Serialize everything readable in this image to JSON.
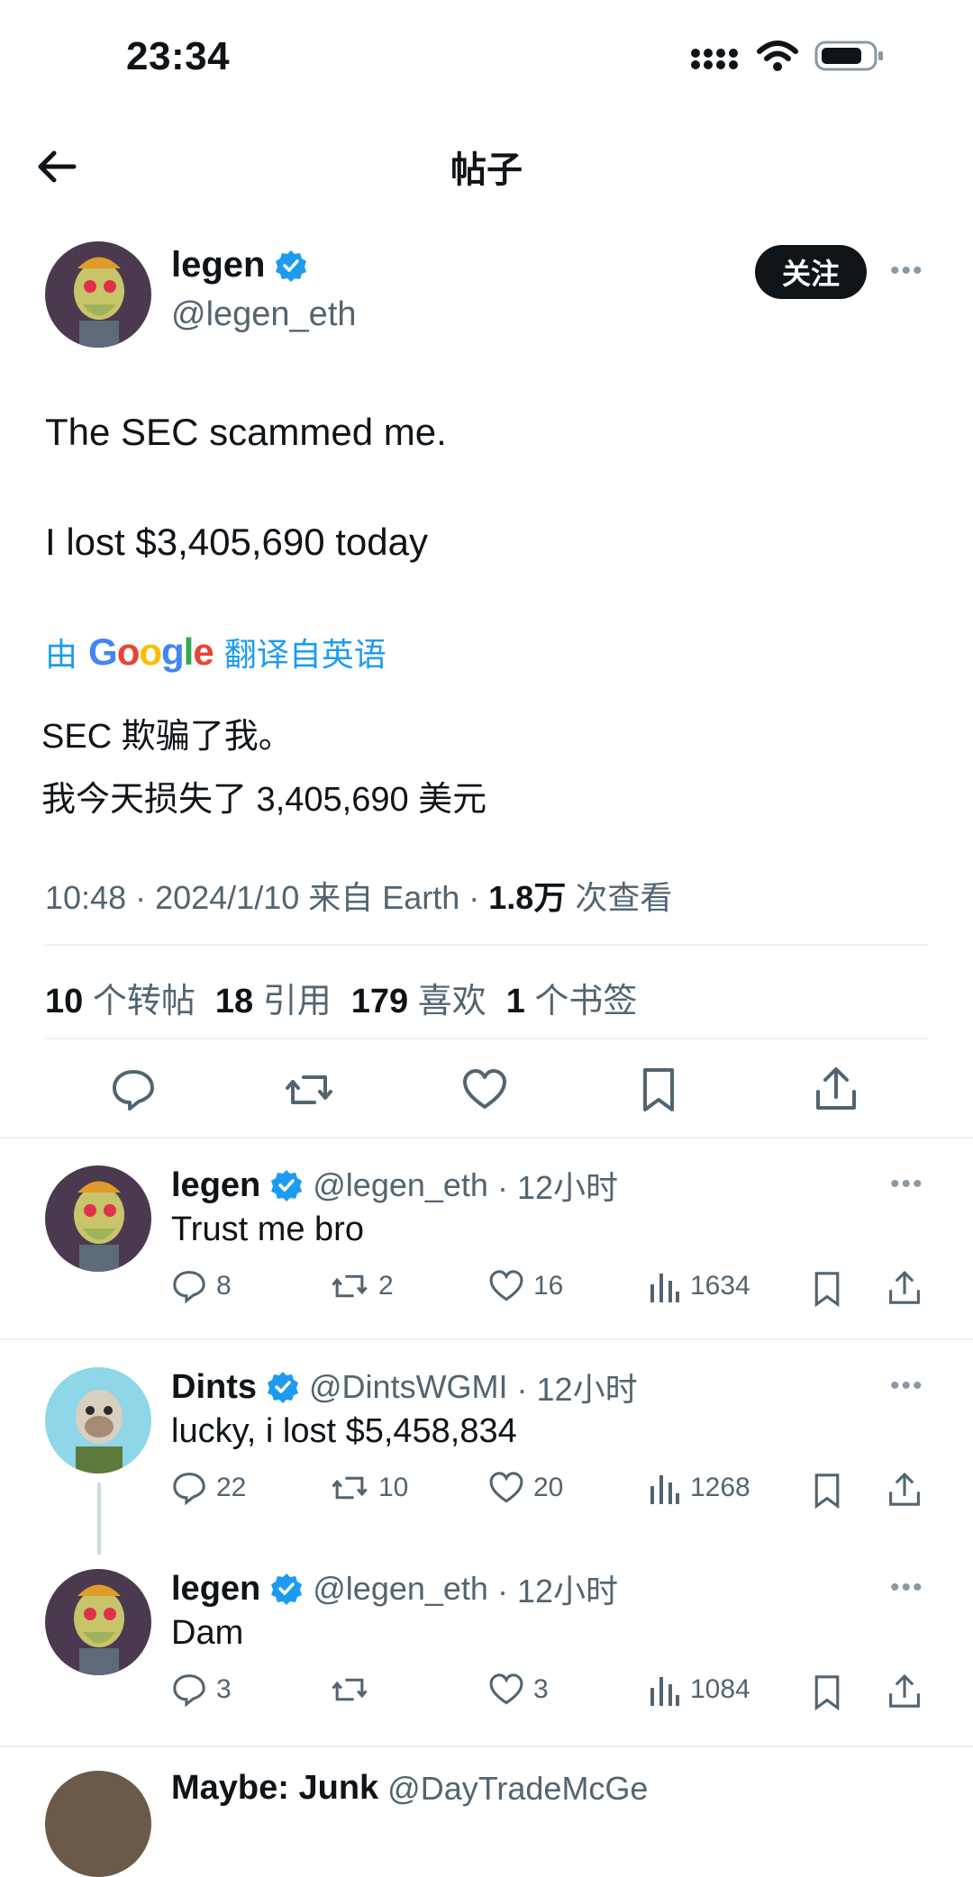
{
  "status_bar": {
    "time": "23:34"
  },
  "header": {
    "title": "帖子"
  },
  "main_tweet": {
    "name": "legen",
    "handle": "@legen_eth",
    "follow_label": "关注",
    "text_line1": "The SEC scammed me.",
    "text_line2": "I lost $3,405,690 today",
    "translate_by": "由",
    "translate_google": "Google",
    "translate_from": "翻译自英语",
    "translated_line1": "SEC 欺骗了我。",
    "translated_line2": "我今天损失了 3,405,690 美元",
    "meta_prefix": "10:48 · 2024/1/10 来自 Earth · ",
    "views_count": "1.8万",
    "views_suffix": " 次查看",
    "stats": [
      {
        "count": "10",
        "label": "个转帖"
      },
      {
        "count": "18",
        "label": "引用"
      },
      {
        "count": "179",
        "label": "喜欢"
      },
      {
        "count": "1",
        "label": "个书签"
      }
    ]
  },
  "replies": [
    {
      "name": "legen",
      "handle": "@legen_eth",
      "time": "· 12小时",
      "text": "Trust me bro",
      "comments": "8",
      "retweets": "2",
      "likes": "16",
      "views": "1634"
    },
    {
      "name": "Dints",
      "handle": "@DintsWGMI",
      "time": "· 12小时",
      "text": "lucky, i lost $5,458,834",
      "comments": "22",
      "retweets": "10",
      "likes": "20",
      "views": "1268"
    },
    {
      "name": "legen",
      "handle": "@legen_eth",
      "time": "· 12小时",
      "text": "Dam",
      "comments": "3",
      "retweets": "",
      "likes": "3",
      "views": "1084"
    }
  ],
  "partial_reply": {
    "name": "Maybe: Junk",
    "handle": "@DayTradeMcGe"
  },
  "colors": {
    "accent": "#1d9bf0",
    "text": "#0f1419",
    "muted": "#536471"
  }
}
